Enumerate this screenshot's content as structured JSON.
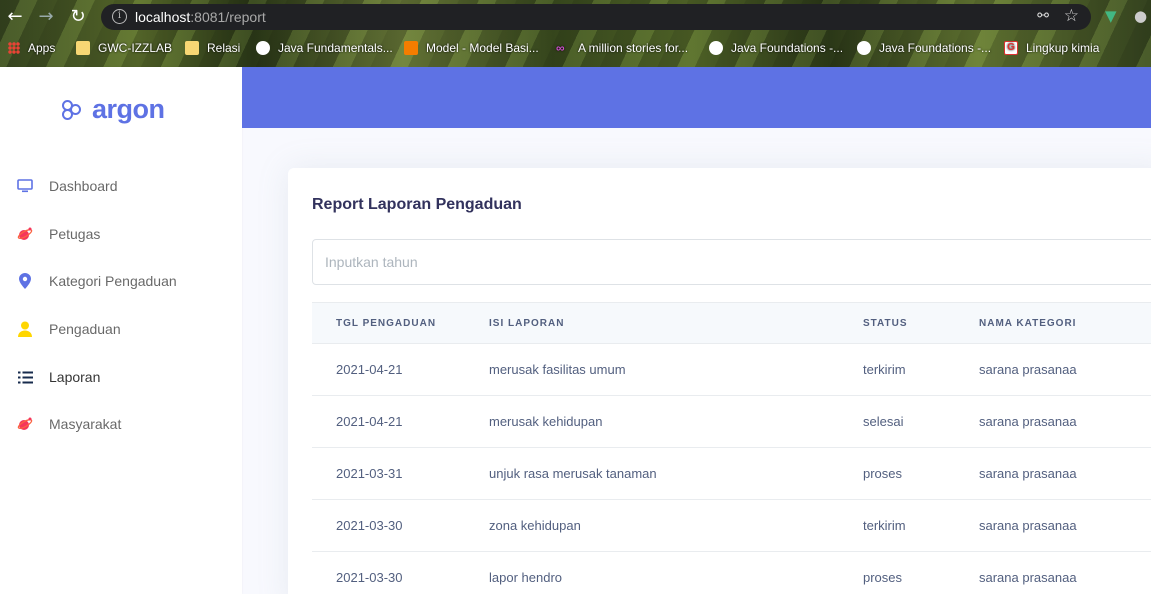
{
  "browser": {
    "url_host": "localhost",
    "url_rest": ":8081/report",
    "bookmarks": [
      {
        "label": "Apps",
        "icon": "apps-grid-icon"
      },
      {
        "label": "GWC-IZZLAB",
        "icon": "folder-icon"
      },
      {
        "label": "Relasi",
        "icon": "folder-icon"
      },
      {
        "label": "Java Fundamentals...",
        "icon": "globe-icon"
      },
      {
        "label": "Model - Model Basi...",
        "icon": "blogger-icon"
      },
      {
        "label": "A million stories for...",
        "icon": "infinity-icon"
      },
      {
        "label": "Java Foundations -...",
        "icon": "globe-icon"
      },
      {
        "label": "Java Foundations -...",
        "icon": "globe-icon"
      },
      {
        "label": "Lingkup kimia",
        "icon": "g-icon"
      }
    ]
  },
  "sidebar": {
    "brand": "argon",
    "items": [
      {
        "label": "Dashboard",
        "icon": "monitor-icon",
        "color": "#5e72e4"
      },
      {
        "label": "Petugas",
        "icon": "planet-icon",
        "color": "#f5365c"
      },
      {
        "label": "Kategori Pengaduan",
        "icon": "pin-icon",
        "color": "#5e72e4"
      },
      {
        "label": "Pengaduan",
        "icon": "user-icon",
        "color": "#ffd600"
      },
      {
        "label": "Laporan",
        "icon": "list-icon",
        "color": "#172b4d"
      },
      {
        "label": "Masyarakat",
        "icon": "planet-icon",
        "color": "#f5365c"
      }
    ]
  },
  "main": {
    "title": "Report Laporan Pengaduan",
    "year_placeholder": "Inputkan tahun",
    "columns": [
      "TGL PENGADUAN",
      "ISI LAPORAN",
      "STATUS",
      "NAMA KATEGORI"
    ],
    "rows": [
      [
        "2021-04-21",
        "merusak fasilitas umum",
        "terkirim",
        "sarana prasanaa"
      ],
      [
        "2021-04-21",
        "merusak kehidupan",
        "selesai",
        "sarana prasanaa"
      ],
      [
        "2021-03-31",
        "unjuk rasa merusak tanaman",
        "proses",
        "sarana prasanaa"
      ],
      [
        "2021-03-30",
        "zona kehidupan",
        "terkirim",
        "sarana prasanaa"
      ],
      [
        "2021-03-30",
        "lapor hendro",
        "proses",
        "sarana prasanaa"
      ]
    ]
  },
  "colors": {
    "primary": "#5e72e4",
    "text": "#525f7f",
    "heading": "#32325d"
  }
}
